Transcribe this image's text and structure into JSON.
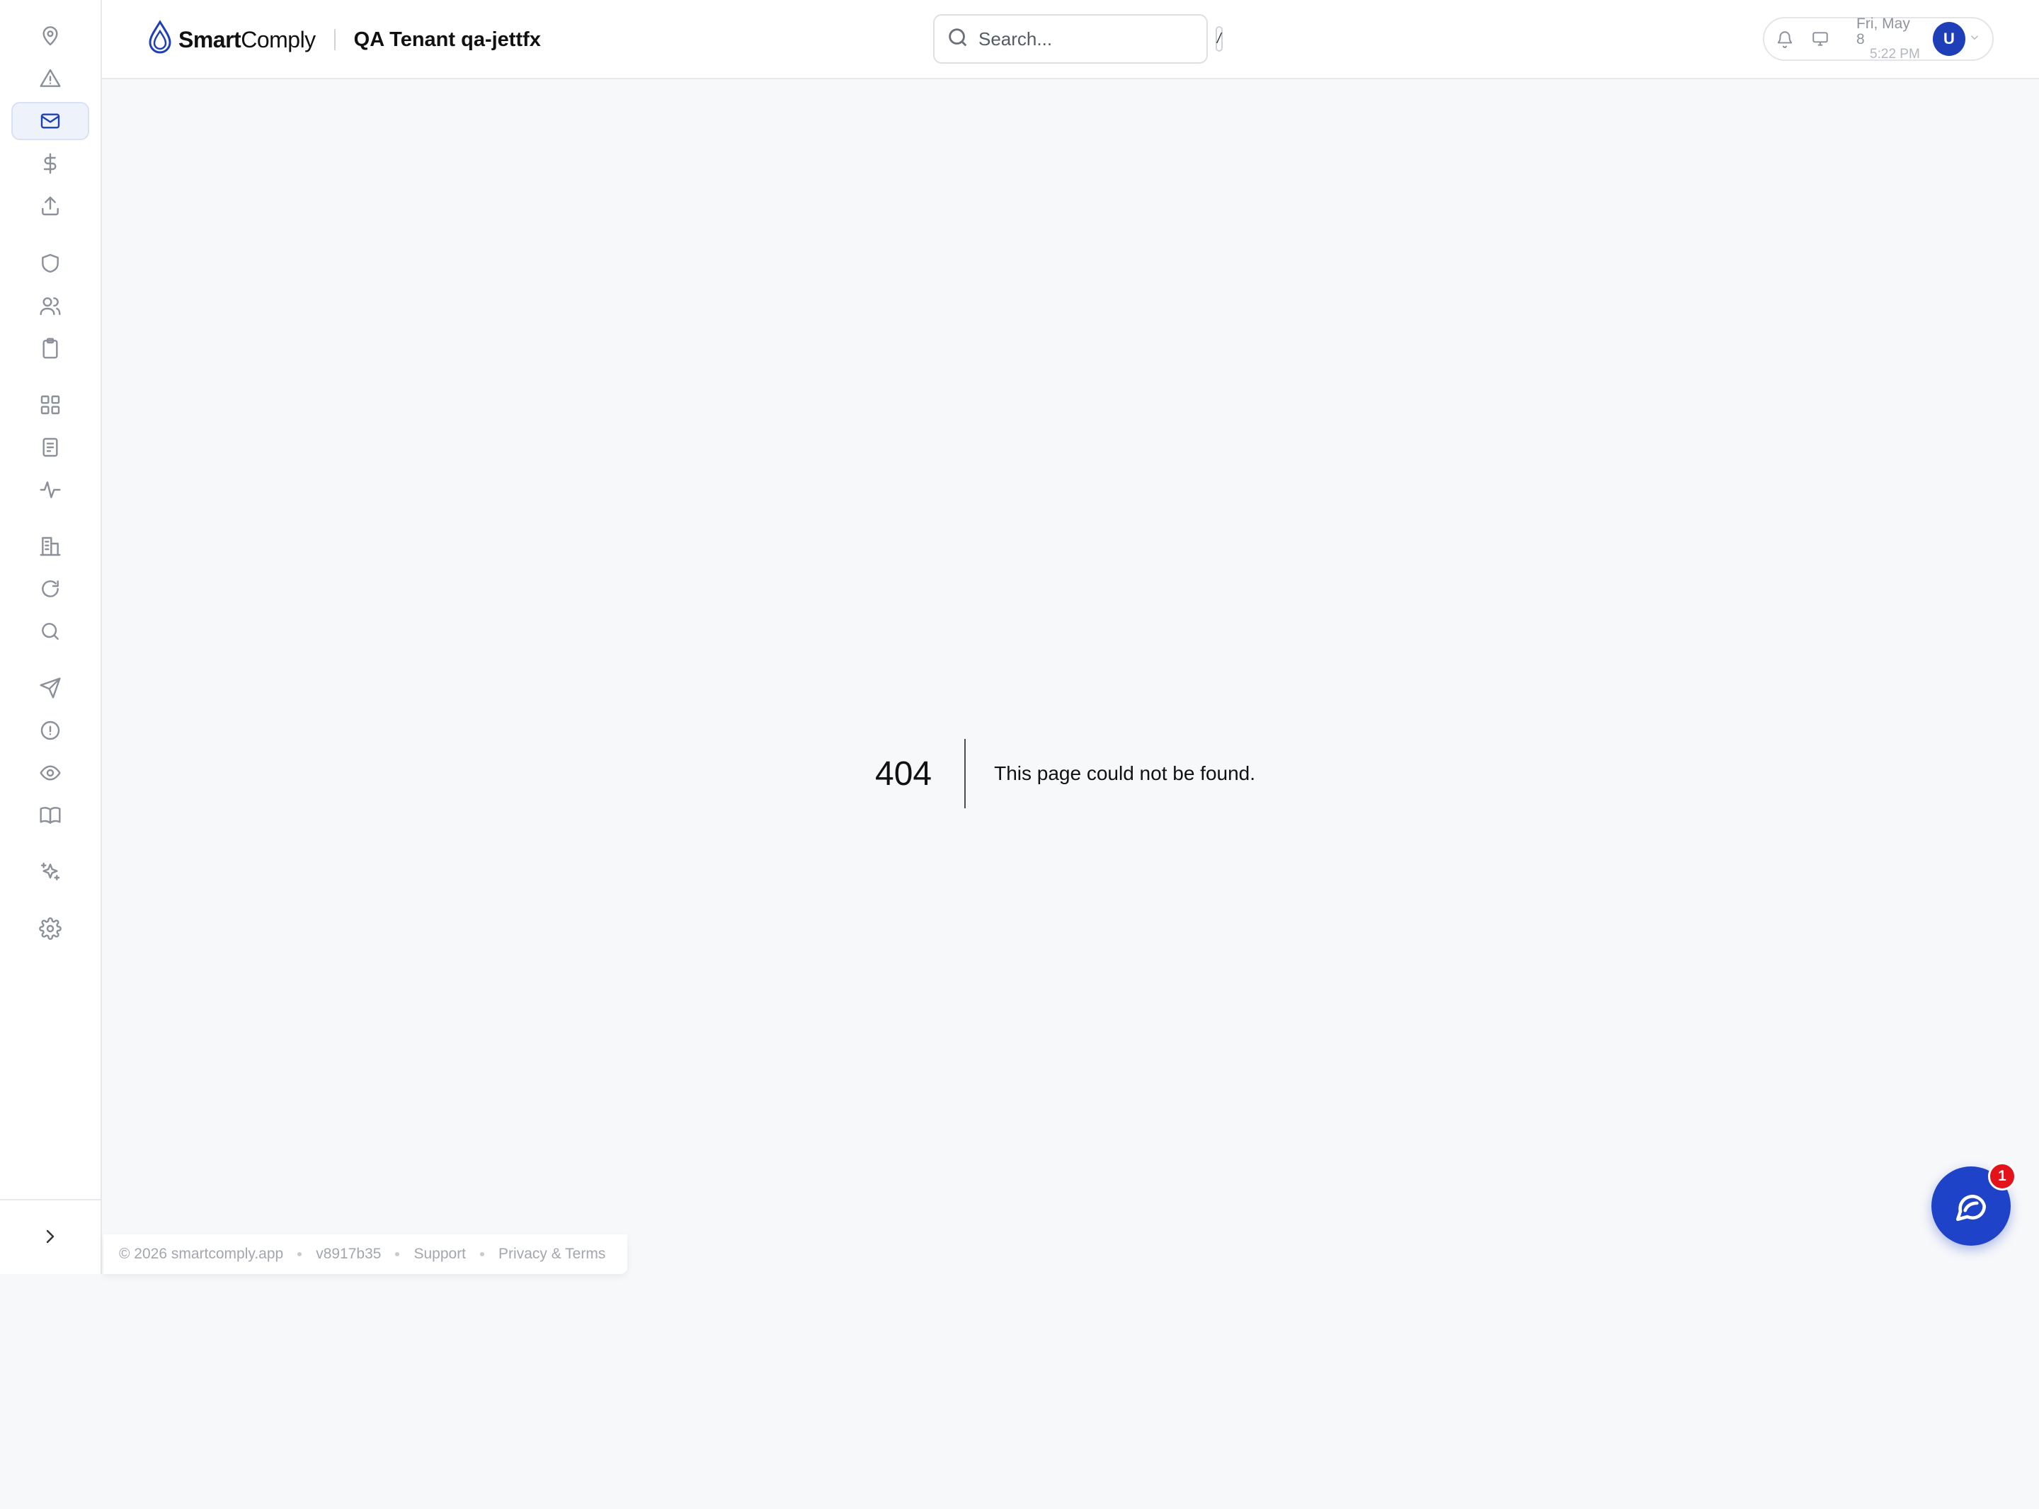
{
  "brand": {
    "name_bold": "Smart",
    "name_light": "Comply",
    "accent_color": "#1f3fb8"
  },
  "header": {
    "tenant": "QA Tenant qa-jettfx"
  },
  "search": {
    "placeholder": "Search...",
    "shortcut": "/"
  },
  "user": {
    "date": "Fri, May 8",
    "time": "5:22 PM",
    "avatar_initial": "U",
    "icons": [
      "bell-icon",
      "monitor-icon",
      "chevron-down-icon"
    ]
  },
  "sidebar": {
    "items": [
      {
        "icon": "map-pin-icon",
        "active": false
      },
      {
        "icon": "alert-triangle-icon",
        "active": false
      },
      {
        "icon": "mail-icon",
        "active": true
      },
      {
        "icon": "dollar-icon",
        "active": false
      },
      {
        "icon": "upload-icon",
        "active": false
      },
      {
        "icon": "shield-icon",
        "active": false
      },
      {
        "icon": "users-icon",
        "active": false
      },
      {
        "icon": "clipboard-icon",
        "active": false
      },
      {
        "icon": "grid-icon",
        "active": false
      },
      {
        "icon": "document-icon",
        "active": false
      },
      {
        "icon": "activity-icon",
        "active": false
      },
      {
        "icon": "building-icon",
        "active": false
      },
      {
        "icon": "refresh-icon",
        "active": false
      },
      {
        "icon": "search-icon",
        "active": false
      },
      {
        "icon": "send-icon",
        "active": false
      },
      {
        "icon": "alert-circle-icon",
        "active": false
      },
      {
        "icon": "eye-icon",
        "active": false
      },
      {
        "icon": "book-icon",
        "active": false
      },
      {
        "icon": "sparkles-icon",
        "active": false
      },
      {
        "icon": "gear-icon",
        "active": false
      }
    ],
    "collapse_icon": "chevron-right-icon"
  },
  "not_found": {
    "code": "404",
    "message": "This page could not be found."
  },
  "footer": {
    "copyright": "© 2026 smartcomply.app",
    "version": "v8917b35",
    "support": "Support",
    "privacy": "Privacy & Terms"
  },
  "chat": {
    "badge": "1",
    "icon": "chat-bubble-icon",
    "color": "#1f43c8",
    "badge_color": "#e3121b"
  }
}
